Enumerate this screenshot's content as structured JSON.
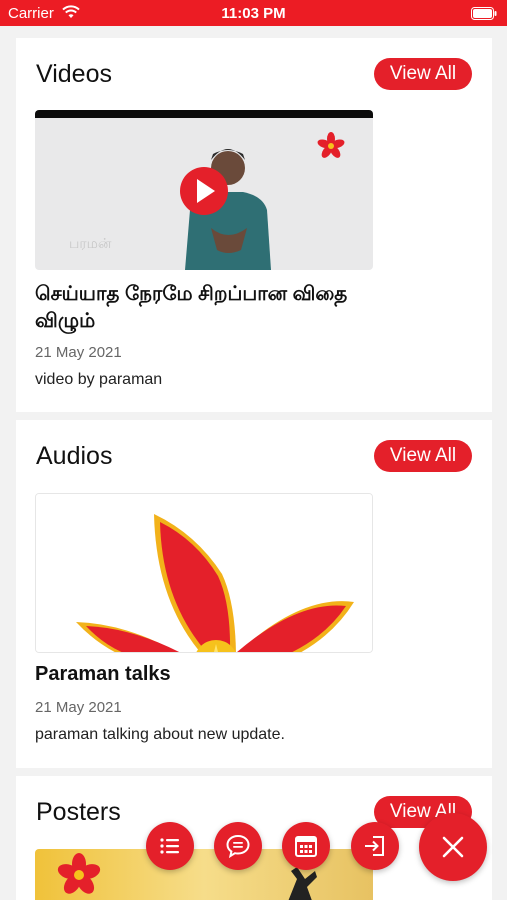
{
  "status_bar": {
    "carrier": "Carrier",
    "time": "11:03 PM"
  },
  "videos": {
    "title": "Videos",
    "view_all_label": "View All",
    "item": {
      "title": "செய்யாத நேரமே சிறப்பான விதை விழும்",
      "date": "21 May 2021",
      "description": "video by paraman",
      "thumbnail_watermark": "பரமன்"
    }
  },
  "audios": {
    "title": "Audios",
    "view_all_label": "View All",
    "item": {
      "title": "Paraman talks",
      "date": "21 May 2021",
      "description": "paraman talking about new update."
    }
  },
  "posters": {
    "title": "Posters",
    "view_all_label": "View All"
  },
  "fab_menu": {
    "items": [
      "list-icon",
      "chat-icon",
      "calendar-icon",
      "login-icon"
    ],
    "close_icon": "close-icon"
  },
  "colors": {
    "accent": "#e4202a",
    "status_bar": "#ec1c24",
    "background": "#f2f2f2"
  }
}
